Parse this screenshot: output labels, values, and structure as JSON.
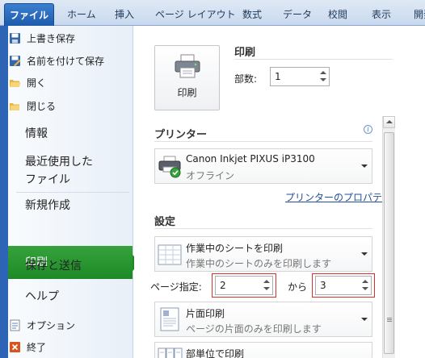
{
  "ribbon": {
    "tabs": [
      "ファイル",
      "ホーム",
      "挿入",
      "ページ レイアウト",
      "数式",
      "データ",
      "校閲",
      "表示",
      "開発"
    ]
  },
  "nav": {
    "small_items": [
      {
        "label": "上書き保存",
        "icon": "save-icon"
      },
      {
        "label": "名前を付けて保存",
        "icon": "save-as-icon"
      },
      {
        "label": "開く",
        "icon": "open-folder-icon"
      },
      {
        "label": "閉じる",
        "icon": "close-folder-icon"
      }
    ],
    "info": "情報",
    "recent": "最近使用した",
    "recent2": "ファイル",
    "new": "新規作成",
    "print": "印刷",
    "save_send": "保存と送信",
    "help": "ヘルプ",
    "options": "オプション",
    "exit": "終了"
  },
  "print": {
    "button_label": "印刷",
    "heading": "印刷",
    "copies_label": "部数:",
    "copies_value": "1"
  },
  "printer": {
    "heading": "プリンター",
    "name": "Canon Inkjet PIXUS iP3100",
    "status": "オフライン",
    "properties_link": "プリンターのプロパティ"
  },
  "settings": {
    "heading": "設定",
    "scope_title": "作業中のシートを印刷",
    "scope_desc": "作業中のシートのみを印刷します",
    "pages_label": "ページ指定:",
    "pages_from": "2",
    "pages_to_label": "から",
    "pages_to": "3",
    "sides_title": "片面印刷",
    "sides_desc": "ページの片面のみを印刷します",
    "collate_title": "部単位で印刷"
  },
  "colors": {
    "accent_blue": "#2e64b5",
    "selected_green": "#1e8a27",
    "highlight_red": "#d9302a"
  }
}
